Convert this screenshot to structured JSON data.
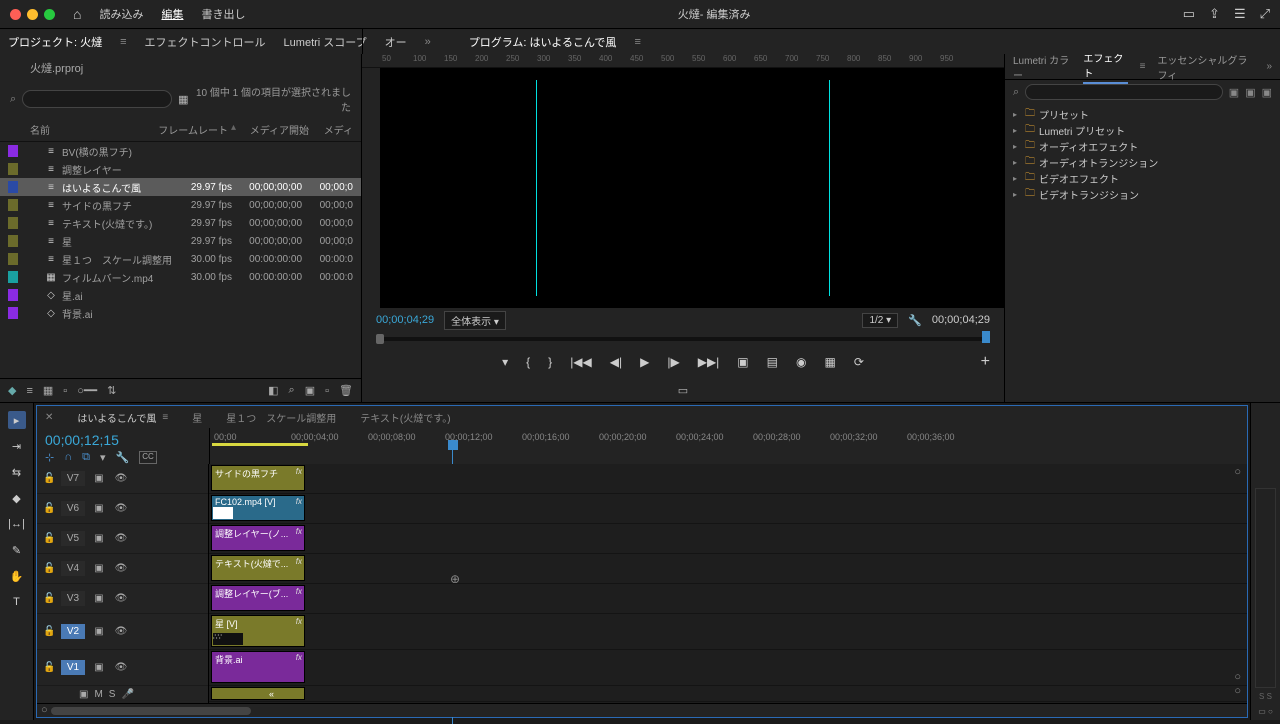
{
  "menubar": {
    "items": [
      "読み込み",
      "編集",
      "書き出し"
    ],
    "active_index": 1,
    "title": "火燵- 編集済み"
  },
  "workspace_tabs": {
    "left": [
      "プロジェクト: 火燵",
      "エフェクトコントロール",
      "Lumetri スコープ",
      "オー"
    ],
    "program_label": "プログラム: はいよるこんで風"
  },
  "project": {
    "filename": "火燵.prproj",
    "search_placeholder": "",
    "count_text": "10 個中 1 個の項目が選択されました",
    "columns": {
      "name": "名前",
      "framerate": "フレームレート",
      "media_start": "メディア開始",
      "media_dur": "メディ"
    },
    "items": [
      {
        "color": "#8a2be2",
        "icon": "≡",
        "name": "BV(横の黒フチ)",
        "fr": "",
        "ms": "",
        "md": ""
      },
      {
        "color": "#6b6b2b",
        "icon": "≡",
        "name": "調整レイヤー",
        "fr": "",
        "ms": "",
        "md": ""
      },
      {
        "color": "#2a4aa5",
        "icon": "≡",
        "name": "はいよるこんで風",
        "fr": "29.97 fps",
        "ms": "00;00;00;00",
        "md": "00;00;0",
        "selected": true
      },
      {
        "color": "#6b6b2b",
        "icon": "≡",
        "name": "サイドの黒フチ",
        "fr": "29.97 fps",
        "ms": "00;00;00;00",
        "md": "00;00;0"
      },
      {
        "color": "#6b6b2b",
        "icon": "≡",
        "name": "テキスト(火燵です。)",
        "fr": "29.97 fps",
        "ms": "00;00;00;00",
        "md": "00;00;0"
      },
      {
        "color": "#6b6b2b",
        "icon": "≡",
        "name": "星",
        "fr": "29.97 fps",
        "ms": "00;00;00;00",
        "md": "00;00;0"
      },
      {
        "color": "#6b6b2b",
        "icon": "≡",
        "name": "星１つ　スケール調整用",
        "fr": "30.00 fps",
        "ms": "00:00:00:00",
        "md": "00:00:0"
      },
      {
        "color": "#1aa0a0",
        "icon": "▦",
        "name": "フィルムバーン.mp4",
        "fr": "30.00 fps",
        "ms": "00:00:00:00",
        "md": "00:00:0"
      },
      {
        "color": "#8a2be2",
        "icon": "◇",
        "name": "星.ai",
        "fr": "",
        "ms": "",
        "md": ""
      },
      {
        "color": "#8a2be2",
        "icon": "◇",
        "name": "背景.ai",
        "fr": "",
        "ms": "",
        "md": ""
      }
    ]
  },
  "program": {
    "ruler_ticks": [
      "50",
      "100",
      "150",
      "200",
      "250",
      "300",
      "350",
      "400",
      "450",
      "500",
      "550",
      "600",
      "650",
      "700",
      "750",
      "800",
      "850",
      "900",
      "950"
    ],
    "timecode_left": "00;00;04;29",
    "fit_label": "全体表示",
    "res_label": "1/2",
    "timecode_right": "00;00;04;29"
  },
  "effects": {
    "tabs": [
      "Lumetri カラー",
      "エフェクト",
      "エッセンシャルグラフィ"
    ],
    "active_tab": 1,
    "tree": [
      "プリセット",
      "Lumetri プリセット",
      "オーディオエフェクト",
      "オーディオトランジション",
      "ビデオエフェクト",
      "ビデオトランジション"
    ]
  },
  "timeline": {
    "tabs": [
      "はいよるこんで風",
      "星",
      "星１つ　スケール調整用",
      "テキスト(火燵です。)"
    ],
    "active_tab": 0,
    "timecode": "00;00;12;15",
    "ruler": [
      "00;00",
      "00;00;04;00",
      "00;00;08;00",
      "00;00;12;00",
      "00;00;16;00",
      "00;00;20;00",
      "00;00;24;00",
      "00;00;28;00",
      "00;00;32;00",
      "00;00;36;00"
    ],
    "tracks": [
      {
        "label": "V7",
        "clip": {
          "name": "サイドの黒フチ",
          "color": "#7a7a2a",
          "fx": true
        }
      },
      {
        "label": "V6",
        "clip": {
          "name": "FC102.mp4 [V]",
          "color": "#2a6a8a",
          "fx": true,
          "thumb": true
        }
      },
      {
        "label": "V5",
        "clip": {
          "name": "調整レイヤー(ノ...",
          "color": "#7a2a9a",
          "fx": true
        }
      },
      {
        "label": "V4",
        "clip": {
          "name": "テキスト(火燵で...",
          "color": "#7a7a2a",
          "fx": true
        }
      },
      {
        "label": "V3",
        "clip": {
          "name": "調整レイヤー(ブ...",
          "color": "#7a2a9a",
          "fx": true
        }
      },
      {
        "label": "V2",
        "active": true,
        "clip": {
          "name": "星 [V]",
          "color": "#7a7a2a",
          "fx": true,
          "thumb2": true
        }
      },
      {
        "label": "V1",
        "active": true,
        "clip": {
          "name": "背景.ai",
          "color": "#7a2a9a",
          "fx": true
        }
      }
    ],
    "audio_label": "S S"
  }
}
